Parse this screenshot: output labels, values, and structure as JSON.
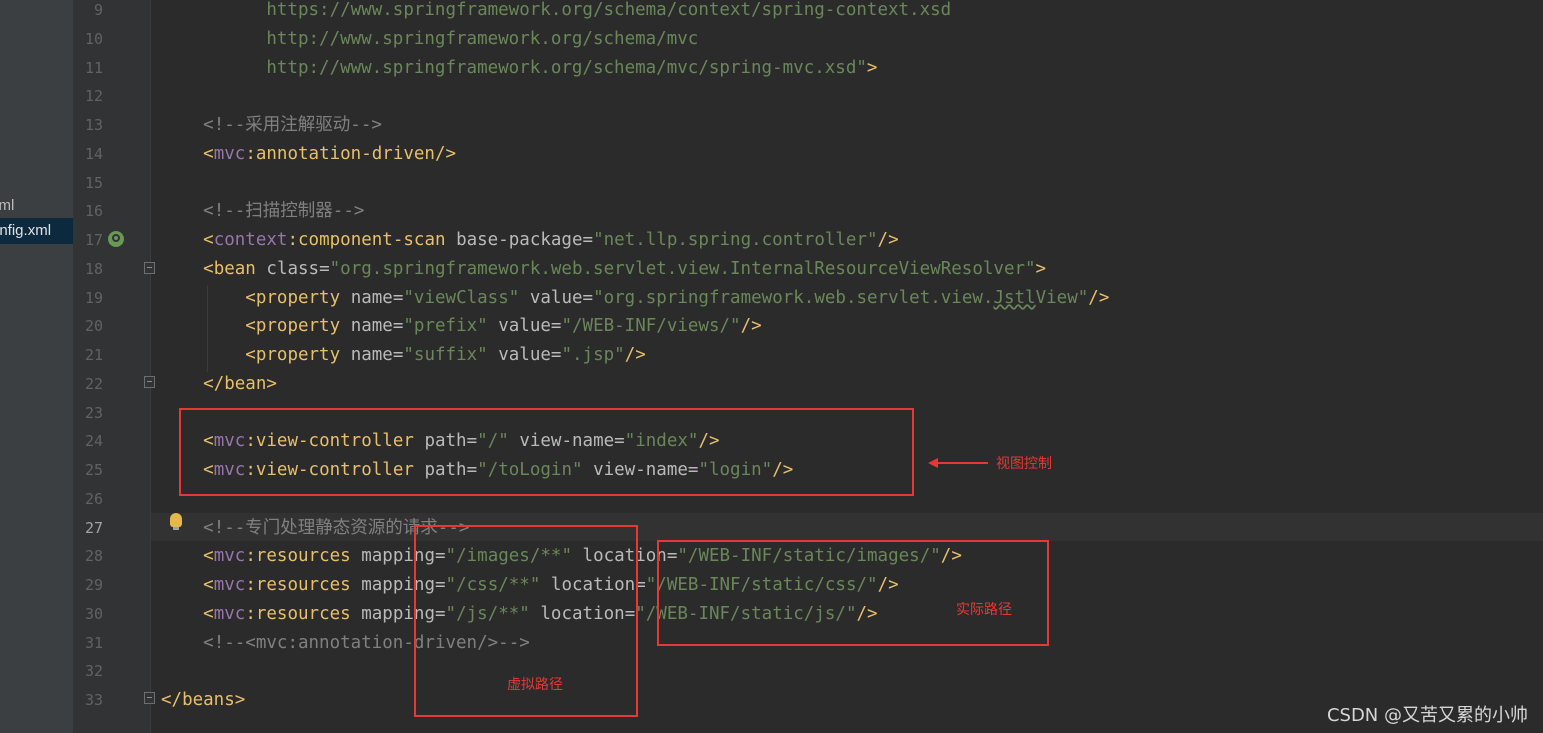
{
  "sidebar": {
    "items": [
      {
        "label": "xml",
        "selected": false
      },
      {
        "label": "onfig.xml",
        "selected": true
      }
    ]
  },
  "editor": {
    "line_numbers": [
      "9",
      "10",
      "11",
      "12",
      "13",
      "14",
      "15",
      "16",
      "17",
      "18",
      "19",
      "20",
      "21",
      "22",
      "23",
      "24",
      "25",
      "26",
      "27",
      "28",
      "29",
      "30",
      "31",
      "32",
      "33"
    ],
    "active_line": "27",
    "lines": {
      "l9": "https://www.springframework.org/schema/context/spring-context.xsd",
      "l10": "http://www.springframework.org/schema/mvc",
      "l11_val": "http://www.springframework.org/schema/mvc/spring-mvc.xsd\"",
      "l13": "<!--采用注解驱动-->",
      "l16": "<!--扫描控制器-->",
      "l27": "<!--专门处理静态资源的请求-->",
      "l31": "<!--<mvc:annotation-driven/>-->"
    },
    "tokens": {
      "mvc": "mvc",
      "context": "context",
      "annotation_driven": "annotation-driven",
      "component_scan": "component-scan",
      "base_package_attr": "base-package",
      "base_package_val": "\"net.llp.spring.controller\"",
      "bean": "bean",
      "class_attr": "class",
      "class_val": "\"org.springframework.web.servlet.view.InternalResourceViewResolver\"",
      "property": "property",
      "name_attr": "name",
      "value_attr": "value",
      "viewClass_val": "\"viewClass\"",
      "jstl_val_a": "\"org.springframework.web.servlet.view.",
      "jstl_val_b": "Jstl",
      "jstl_val_c": "View\"",
      "prefix_val": "\"prefix\"",
      "prefix_path": "\"/WEB-INF/views/\"",
      "suffix_val": "\"suffix\"",
      "suffix_ext": "\".jsp\"",
      "view_controller": "view-controller",
      "path_attr": "path",
      "view_name_attr": "view-name",
      "path_root": "\"/\"",
      "index_val": "\"index\"",
      "path_login": "\"/toLogin\"",
      "login_val": "\"login\"",
      "resources": "resources",
      "mapping_attr": "mapping",
      "location_attr": "location",
      "images_map": "\"/images/**\"",
      "images_loc": "\"/WEB-INF/static/images/\"",
      "css_map": "\"/css/**\"",
      "css_loc": "\"/WEB-INF/static/css/\"",
      "js_map": "\"/js/**\"",
      "js_loc": "\"/WEB-INF/static/js/\"",
      "beans": "beans"
    }
  },
  "annotations": {
    "view_control": "视图控制",
    "real_path": "实际路径",
    "virtual_path": "虚拟路径"
  },
  "watermark": "CSDN @又苦又累的小帅"
}
